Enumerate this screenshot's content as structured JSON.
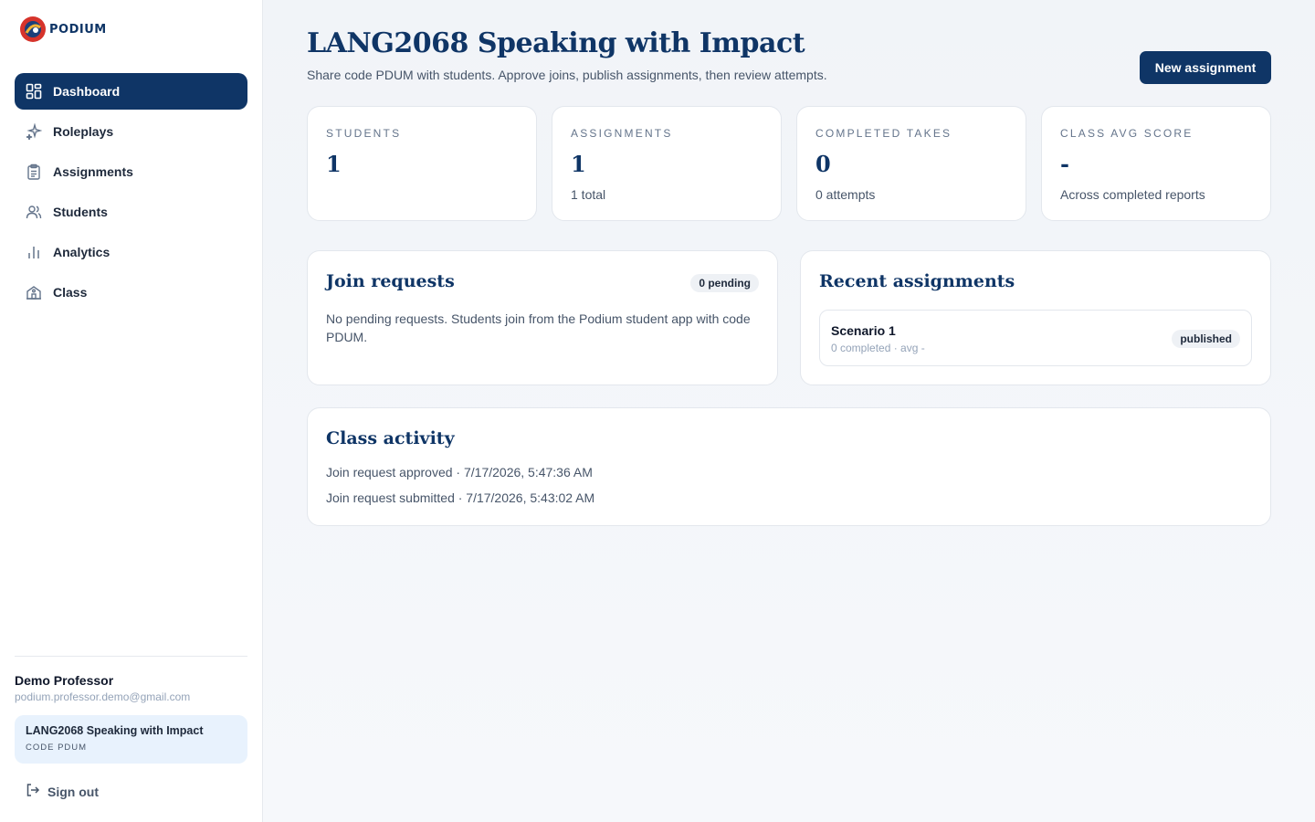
{
  "brand": {
    "name": "PODIUM"
  },
  "nav": {
    "items": [
      {
        "label": "Dashboard",
        "icon": "dashboard-icon",
        "active": true
      },
      {
        "label": "Roleplays",
        "icon": "sparkles-icon"
      },
      {
        "label": "Assignments",
        "icon": "clipboard-icon"
      },
      {
        "label": "Students",
        "icon": "users-icon"
      },
      {
        "label": "Analytics",
        "icon": "bar-chart-icon"
      },
      {
        "label": "Class",
        "icon": "school-icon"
      }
    ]
  },
  "user": {
    "name": "Demo Professor",
    "email": "podium.professor.demo@gmail.com"
  },
  "current_class": {
    "name": "LANG2068 Speaking with Impact",
    "code": "CODE PDUM"
  },
  "signout": {
    "label": "Sign out"
  },
  "header": {
    "title": "LANG2068 Speaking with Impact",
    "subtitle": "Share code PDUM with students. Approve joins, publish assignments, then review attempts.",
    "new_button": "New assignment"
  },
  "stats": [
    {
      "label": "STUDENTS",
      "value": "1",
      "note": ""
    },
    {
      "label": "ASSIGNMENTS",
      "value": "1",
      "note": "1 total"
    },
    {
      "label": "COMPLETED TAKES",
      "value": "0",
      "note": "0 attempts"
    },
    {
      "label": "CLASS AVG SCORE",
      "value": "-",
      "note": "Across completed reports"
    }
  ],
  "join_requests": {
    "title": "Join requests",
    "badge": "0 pending",
    "empty_text": "No pending requests. Students join from the Podium student app with code PDUM."
  },
  "recent_assignments": {
    "title": "Recent assignments",
    "items": [
      {
        "name": "Scenario 1",
        "meta": "0 completed · avg -",
        "status": "published"
      }
    ]
  },
  "activity": {
    "title": "Class activity",
    "items": [
      "Join request approved · 7/17/2026, 5:47:36 AM",
      "Join request submitted · 7/17/2026, 5:43:02 AM"
    ]
  }
}
